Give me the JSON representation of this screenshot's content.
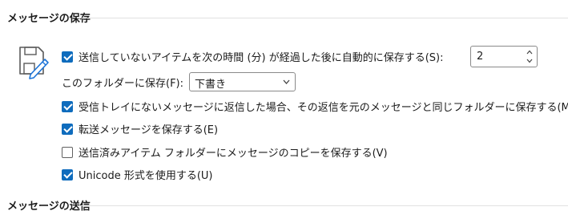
{
  "sections": {
    "save_title": "メッセージの保存",
    "send_title": "メッセージの送信"
  },
  "autosave": {
    "label": "送信していないアイテムを次の時間 (分) が経過した後に自動的に保存する(S):",
    "checked": true,
    "minutes": "2"
  },
  "folder": {
    "label": "このフォルダーに保存(F):",
    "selected": "下書き"
  },
  "options": [
    {
      "label": "受信トレイにないメッセージに返信した場合、その返信を元のメッセージと同じフォルダーに保存する(M)",
      "checked": true
    },
    {
      "label": "転送メッセージを保存する(E)",
      "checked": true
    },
    {
      "label": "送信済みアイテム フォルダーにメッセージのコピーを保存する(V)",
      "checked": false
    },
    {
      "label": "Unicode 形式を使用する(U)",
      "checked": true
    }
  ]
}
